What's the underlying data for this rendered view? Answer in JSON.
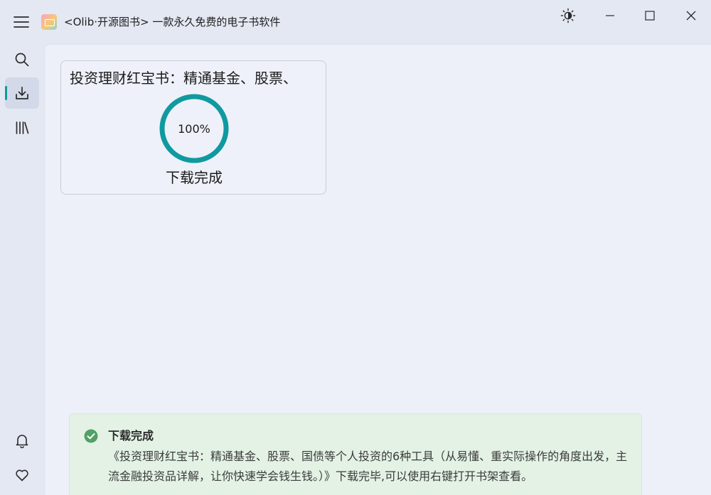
{
  "window": {
    "title": "<Olib·开源图书> 一款永久免费的电子书软件",
    "icons": {
      "menu": "hamburger-menu-icon",
      "app": "app-logo-icon",
      "theme": "brightness-icon",
      "minimize": "minimize-icon",
      "maximize": "maximize-icon",
      "close": "close-icon"
    }
  },
  "sidebar": {
    "items": [
      {
        "name": "search",
        "icon": "search-icon",
        "active": false
      },
      {
        "name": "downloads",
        "icon": "download-icon",
        "active": true
      },
      {
        "name": "library",
        "icon": "bookshelf-icon",
        "active": false
      }
    ],
    "bottom_items": [
      {
        "name": "notifications",
        "icon": "bell-icon"
      },
      {
        "name": "favorites",
        "icon": "heart-icon"
      }
    ]
  },
  "download_card": {
    "book_title": "投资理财红宝书：精通基金、股票、",
    "progress_percent": 100,
    "progress_label": "100%",
    "status": "下载完成",
    "ring_color": "#0f9a9f"
  },
  "notification": {
    "type": "success",
    "icon": "check-circle-icon",
    "title": "下载完成",
    "message": "《投资理财红宝书：精通基金、股票、国债等个人投资的6种工具（从易懂、重实际操作的角度出发，主流金融投资品详解，让你快速学会钱生钱。）》下载完毕,可以使用右键打开书架查看。",
    "accent_color": "#52a065"
  }
}
